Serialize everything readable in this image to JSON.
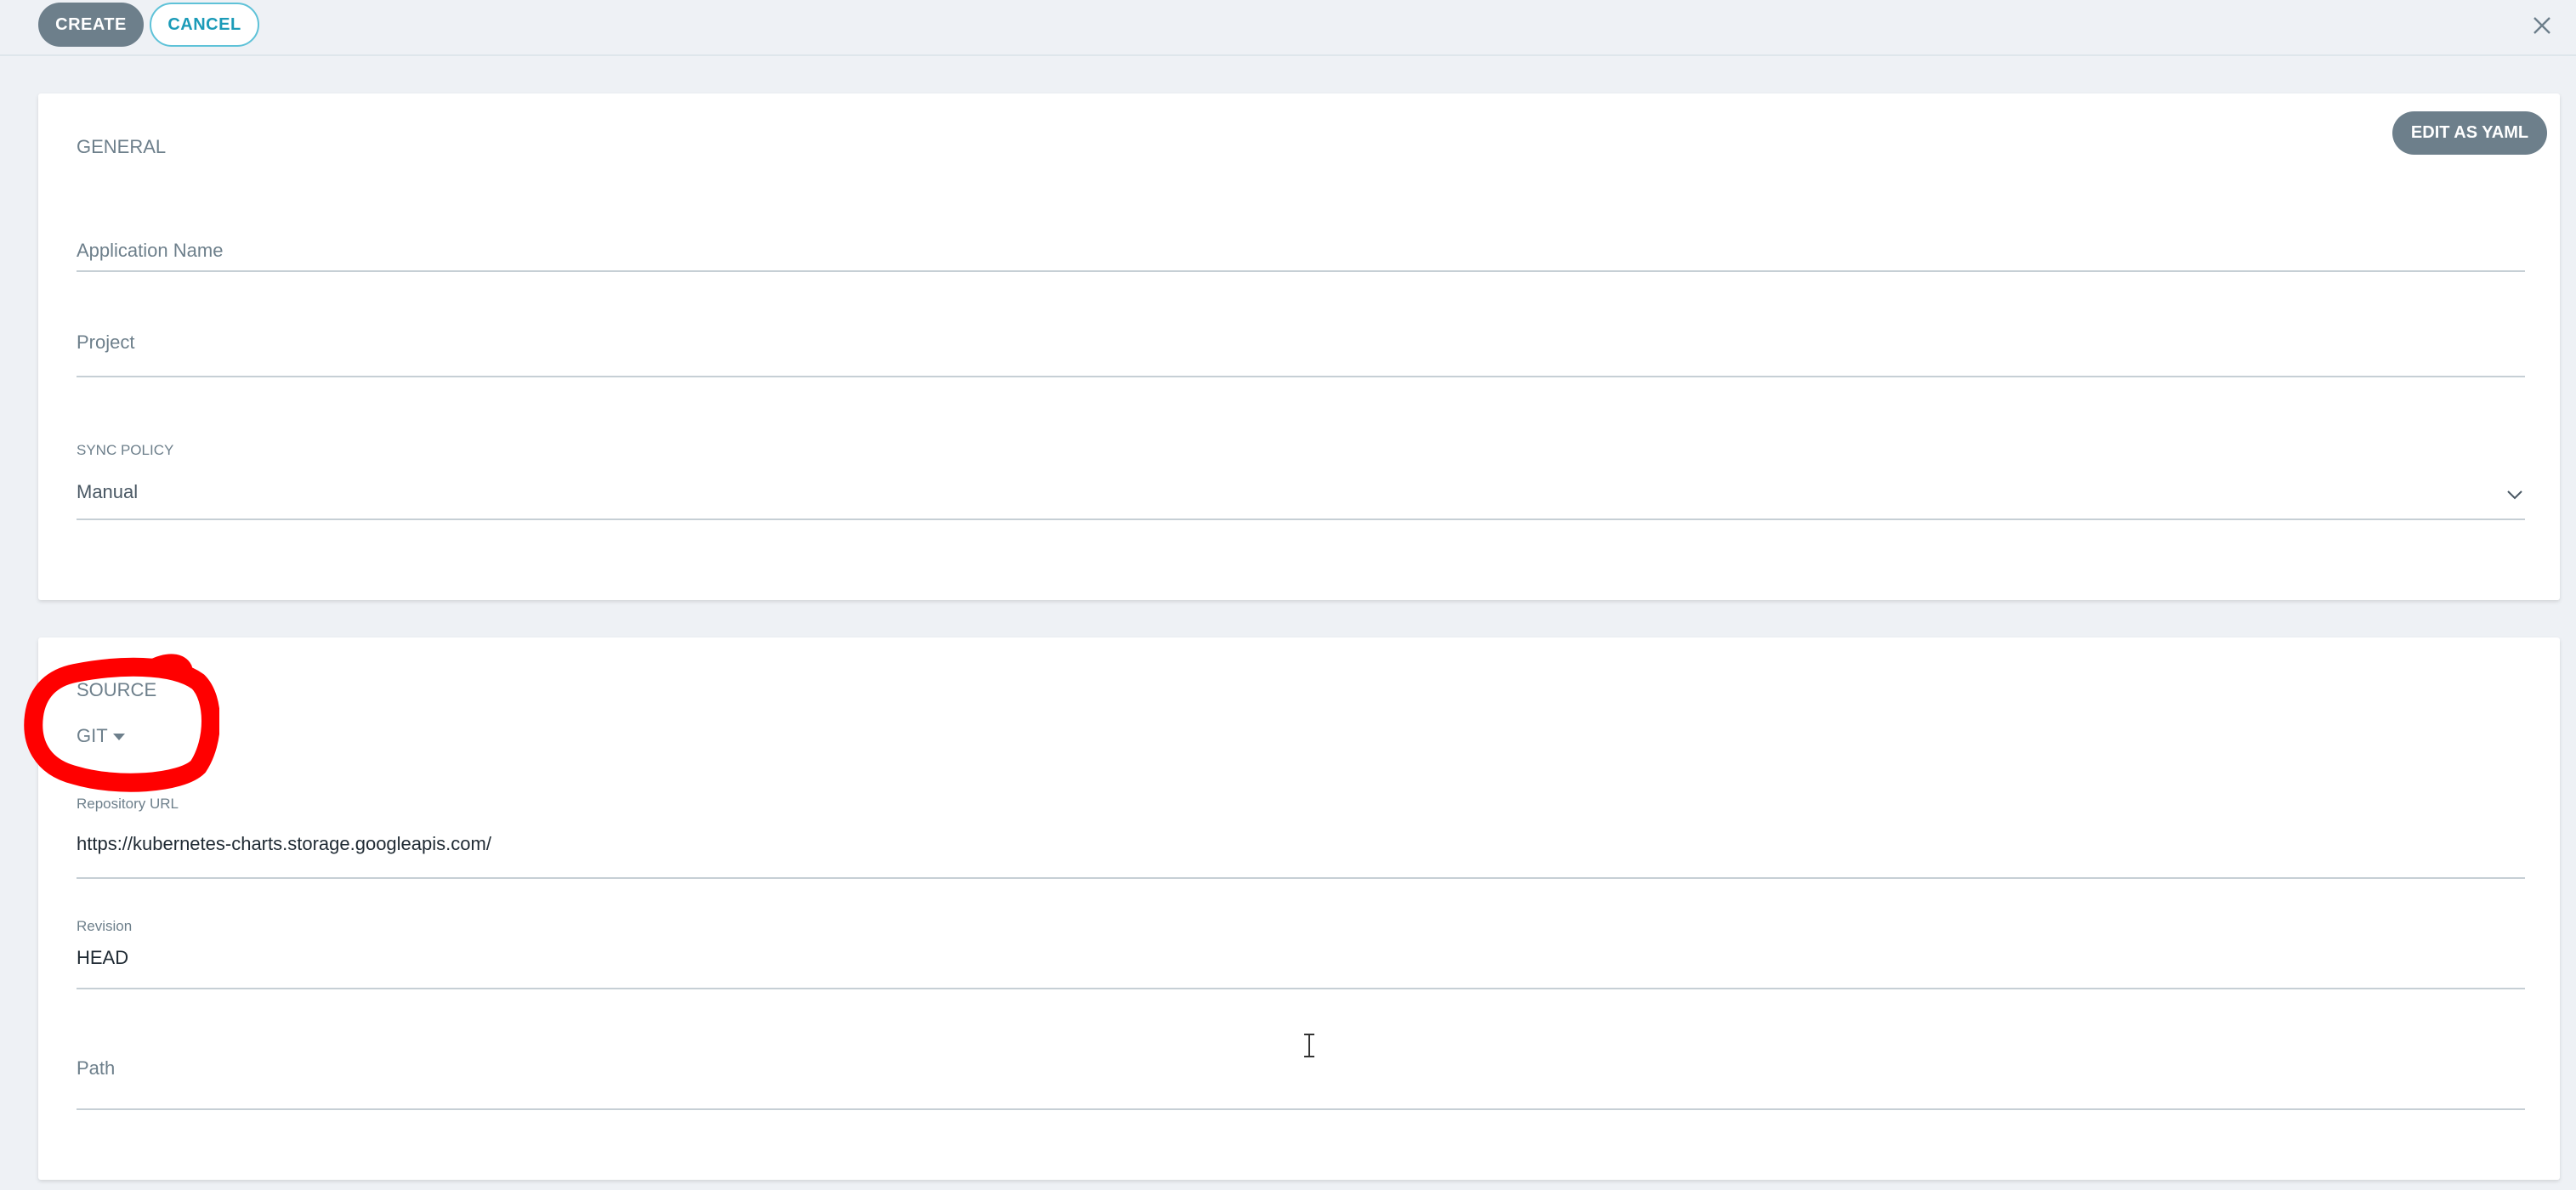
{
  "toolbar": {
    "create_label": "CREATE",
    "cancel_label": "CANCEL"
  },
  "general": {
    "title": "GENERAL",
    "edit_yaml_label": "EDIT AS YAML",
    "application_name_placeholder": "Application Name",
    "project_placeholder": "Project",
    "sync_policy_label": "SYNC POLICY",
    "sync_policy_value": "Manual"
  },
  "source": {
    "title": "SOURCE",
    "type_value": "GIT",
    "repo_url_label": "Repository URL",
    "repo_url_value": "https://kubernetes-charts.storage.googleapis.com/",
    "revision_label": "Revision",
    "revision_value": "HEAD",
    "path_placeholder": "Path"
  },
  "colors": {
    "primary_button": "#6d7f8b",
    "accent": "#1b9bb8",
    "annotation": "#ff0000",
    "background": "#eef1f5"
  },
  "icons": [
    "close-icon",
    "chevron-down-icon",
    "caret-down-icon",
    "text-cursor-icon"
  ]
}
